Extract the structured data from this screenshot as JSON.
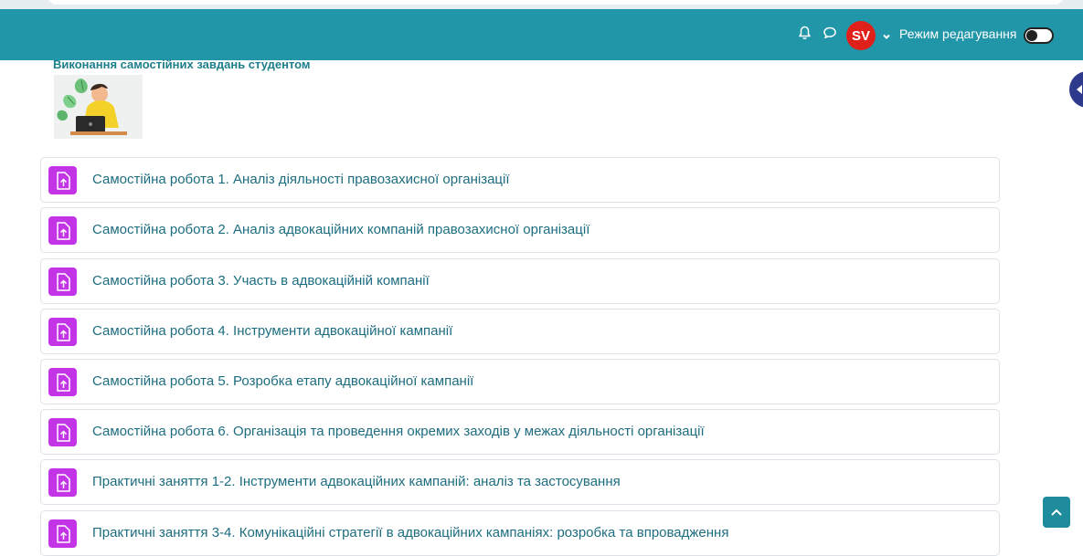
{
  "navbar": {
    "avatar_initials": "SV",
    "edit_mode_label": "Режим редагування",
    "edit_mode_on": false,
    "icons": [
      "bell-icon",
      "chat-icon",
      "chevron-down-icon"
    ],
    "color": "#2196a8"
  },
  "section": {
    "title": "Виконання самостійних завдань студентом"
  },
  "activities": [
    {
      "label": "Самостійна робота 1. Аналіз діяльності правозахисної організації"
    },
    {
      "label": "Самостійна робота 2. Аналіз адвокаційних компаній правозахисної організації"
    },
    {
      "label": "Самостійна робота 3. Участь в адвокаційній компанії"
    },
    {
      "label": "Самостійна робота 4. Інструменти адвокаційної кампанії"
    },
    {
      "label": "Самостійна робота 5. Розробка етапу адвокаційної кампанії"
    },
    {
      "label": "Самостійна робота 6. Організація та проведення окремих заходів у межах діяльності організації"
    },
    {
      "label": "Практичні заняття 1-2. Інструменти адвокаційних кампаній: аналіз та застосування"
    },
    {
      "label": "Практичні заняття 3-4. Комунікаційні стратегії в адвокаційних кампаніях: розробка та впровадження"
    }
  ],
  "colors": {
    "assignment_icon": "#c334e6",
    "link_text": "#1d6d80",
    "avatar": "#e0211b"
  }
}
